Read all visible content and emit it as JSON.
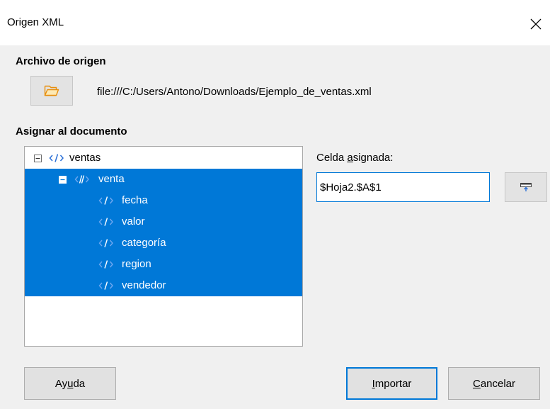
{
  "window": {
    "title": "Origen XML",
    "close_icon": "close-icon"
  },
  "source": {
    "label": "Archivo de origen",
    "browse_icon": "folder-open-icon",
    "file_path": "file:///C:/Users/Antono/Downloads/Ejemplo_de_ventas.xml"
  },
  "mapping": {
    "label": "Asignar al documento",
    "tree": [
      {
        "label": "ventas",
        "expanded": true,
        "selected": false,
        "icon": "xml-element-icon"
      },
      {
        "label": "venta",
        "expanded": true,
        "selected": true,
        "icon": "xml-repeating-element-icon"
      },
      {
        "label": "fecha",
        "selected": true,
        "icon": "xml-attribute-icon"
      },
      {
        "label": "valor",
        "selected": true,
        "icon": "xml-attribute-icon"
      },
      {
        "label": "categoría",
        "selected": true,
        "icon": "xml-attribute-icon"
      },
      {
        "label": "region",
        "selected": true,
        "icon": "xml-attribute-icon"
      },
      {
        "label": "vendedor",
        "selected": true,
        "icon": "xml-attribute-icon"
      }
    ]
  },
  "cell": {
    "label_pre": "Celda ",
    "label_mnemonic": "a",
    "label_post": "signada:",
    "value": "$Hoja2.$A$1",
    "shrink_icon": "shrink-dialog-icon"
  },
  "buttons": {
    "help_pre": "Ay",
    "help_mnemonic": "u",
    "help_post": "da",
    "import_mnemonic": "I",
    "import_post": "mportar",
    "cancel_mnemonic": "C",
    "cancel_post": "ancelar"
  },
  "colors": {
    "selection": "#0078d7",
    "dialog_bg": "#f0f0f0",
    "titlebar_bg": "#ffffff"
  }
}
